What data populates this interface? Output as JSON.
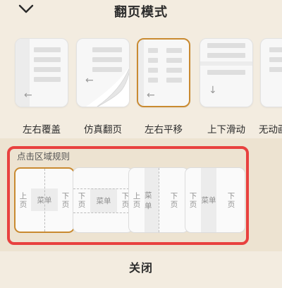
{
  "header": {
    "title": "翻页模式",
    "collapse_icon": "chevron-down-icon"
  },
  "modes": [
    {
      "label": "左右覆盖",
      "selected": false
    },
    {
      "label": "仿真翻页",
      "selected": false
    },
    {
      "label": "左右平移",
      "selected": true
    },
    {
      "label": "上下滑动",
      "selected": false
    },
    {
      "label": "无动画",
      "selected": false
    }
  ],
  "tap_rules": {
    "title": "点击区域规则",
    "zone_prev": "上页",
    "zone_next": "下页",
    "zone_menu": "菜单",
    "selected_index": 0
  },
  "footer": {
    "close_label": "关闭"
  },
  "colors": {
    "accent": "#c98a30",
    "highlight_frame": "#e8413f",
    "background": "#f3ece0"
  }
}
